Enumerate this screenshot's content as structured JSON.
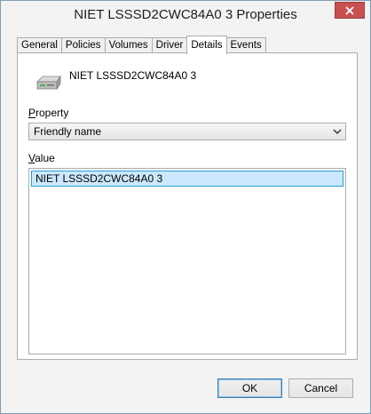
{
  "window": {
    "title": "NIET LSSSD2CWC84A0 3 Properties",
    "close_icon": "close-icon"
  },
  "tabs": [
    {
      "label": "General"
    },
    {
      "label": "Policies"
    },
    {
      "label": "Volumes"
    },
    {
      "label": "Driver"
    },
    {
      "label": "Details",
      "active": true
    },
    {
      "label": "Events"
    }
  ],
  "details": {
    "device_icon": "drive-icon",
    "device_name": "NIET LSSSD2CWC84A0 3",
    "property_label_accel": "P",
    "property_label_rest": "roperty",
    "property_selected": "Friendly name",
    "value_label_accel": "V",
    "value_label_rest": "alue",
    "values": [
      "NIET LSSSD2CWC84A0 3"
    ]
  },
  "buttons": {
    "ok": "OK",
    "cancel": "Cancel"
  },
  "colors": {
    "close_button": "#c75050",
    "selection_fill": "#cce8ff",
    "selection_border": "#26a0da"
  }
}
